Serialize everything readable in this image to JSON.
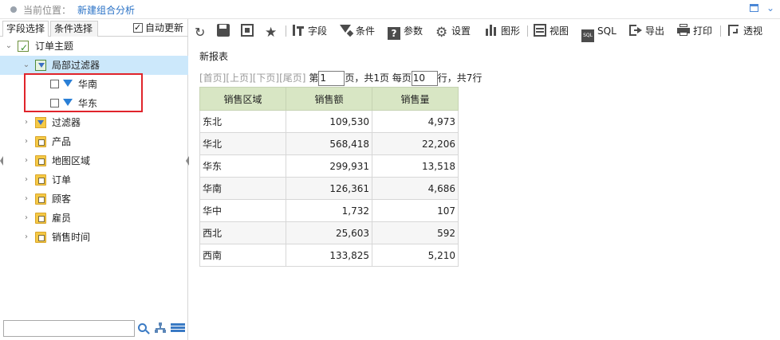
{
  "header": {
    "location_label": "当前位置：",
    "current": "新建组合分析"
  },
  "left_panel": {
    "tabs": [
      {
        "label": "字段选择",
        "active": true
      },
      {
        "label": "条件选择",
        "active": false
      }
    ],
    "auto_update": {
      "label": "自动更新",
      "checked": true
    },
    "tree": {
      "root": {
        "label": "订单主题",
        "icon": "topic-icon"
      },
      "local_filter": {
        "label": "局部过滤器",
        "icon": "filter-group-icon",
        "selected": true
      },
      "local_filter_items": [
        {
          "label": "华南",
          "checked": false,
          "icon": "funnel-icon"
        },
        {
          "label": "华东",
          "checked": false,
          "icon": "funnel-icon"
        }
      ],
      "folders": [
        {
          "label": "过滤器",
          "icon": "filter-folder-icon"
        },
        {
          "label": "产品",
          "icon": "table-folder-icon"
        },
        {
          "label": "地图区域",
          "icon": "table-folder-icon"
        },
        {
          "label": "订单",
          "icon": "table-folder-icon"
        },
        {
          "label": "顾客",
          "icon": "table-folder-icon"
        },
        {
          "label": "雇员",
          "icon": "table-folder-icon"
        },
        {
          "label": "销售时间",
          "icon": "table-folder-icon"
        }
      ]
    },
    "search": {
      "value": "",
      "placeholder": ""
    }
  },
  "toolbar": {
    "buttons": [
      {
        "label": "",
        "icon": "refresh-icon"
      },
      {
        "label": "",
        "icon": "save-icon"
      },
      {
        "label": "",
        "icon": "save-as-icon"
      },
      {
        "label": "",
        "icon": "star-icon"
      },
      {
        "label": "字段",
        "icon": "field-icon"
      },
      {
        "label": "条件",
        "icon": "condition-icon"
      },
      {
        "label": "参数",
        "icon": "parameter-icon"
      },
      {
        "label": "设置",
        "icon": "gear-icon"
      },
      {
        "label": "图形",
        "icon": "chart-icon"
      },
      {
        "label": "视图",
        "icon": "view-icon"
      },
      {
        "label": "SQL",
        "icon": "sql-icon"
      },
      {
        "label": "导出",
        "icon": "export-icon"
      },
      {
        "label": "打印",
        "icon": "print-icon"
      },
      {
        "label": "透视",
        "icon": "pivot-icon"
      }
    ]
  },
  "report": {
    "title": "新报表",
    "pager": {
      "first": "[首页]",
      "prev": "[上页]",
      "next": "[下页]",
      "last": "[尾页]",
      "page_prefix": "第",
      "page_value": "1",
      "page_suffix": "页，共1页 每页",
      "rows_value": "10",
      "rows_suffix": "行，共7行"
    },
    "columns": [
      "销售区域",
      "销售额",
      "销售量"
    ],
    "rows": [
      [
        "东北",
        "109,530",
        "4,973"
      ],
      [
        "华北",
        "568,418",
        "22,206"
      ],
      [
        "华东",
        "299,931",
        "13,518"
      ],
      [
        "华南",
        "126,361",
        "4,686"
      ],
      [
        "华中",
        "1,732",
        "107"
      ],
      [
        "西北",
        "25,603",
        "592"
      ],
      [
        "西南",
        "133,825",
        "5,210"
      ]
    ]
  },
  "colors": {
    "accent": "#2a72c6",
    "header_bg": "#d8e6c4",
    "selection": "#cce8fb",
    "highlight_box": "#e0242b"
  }
}
